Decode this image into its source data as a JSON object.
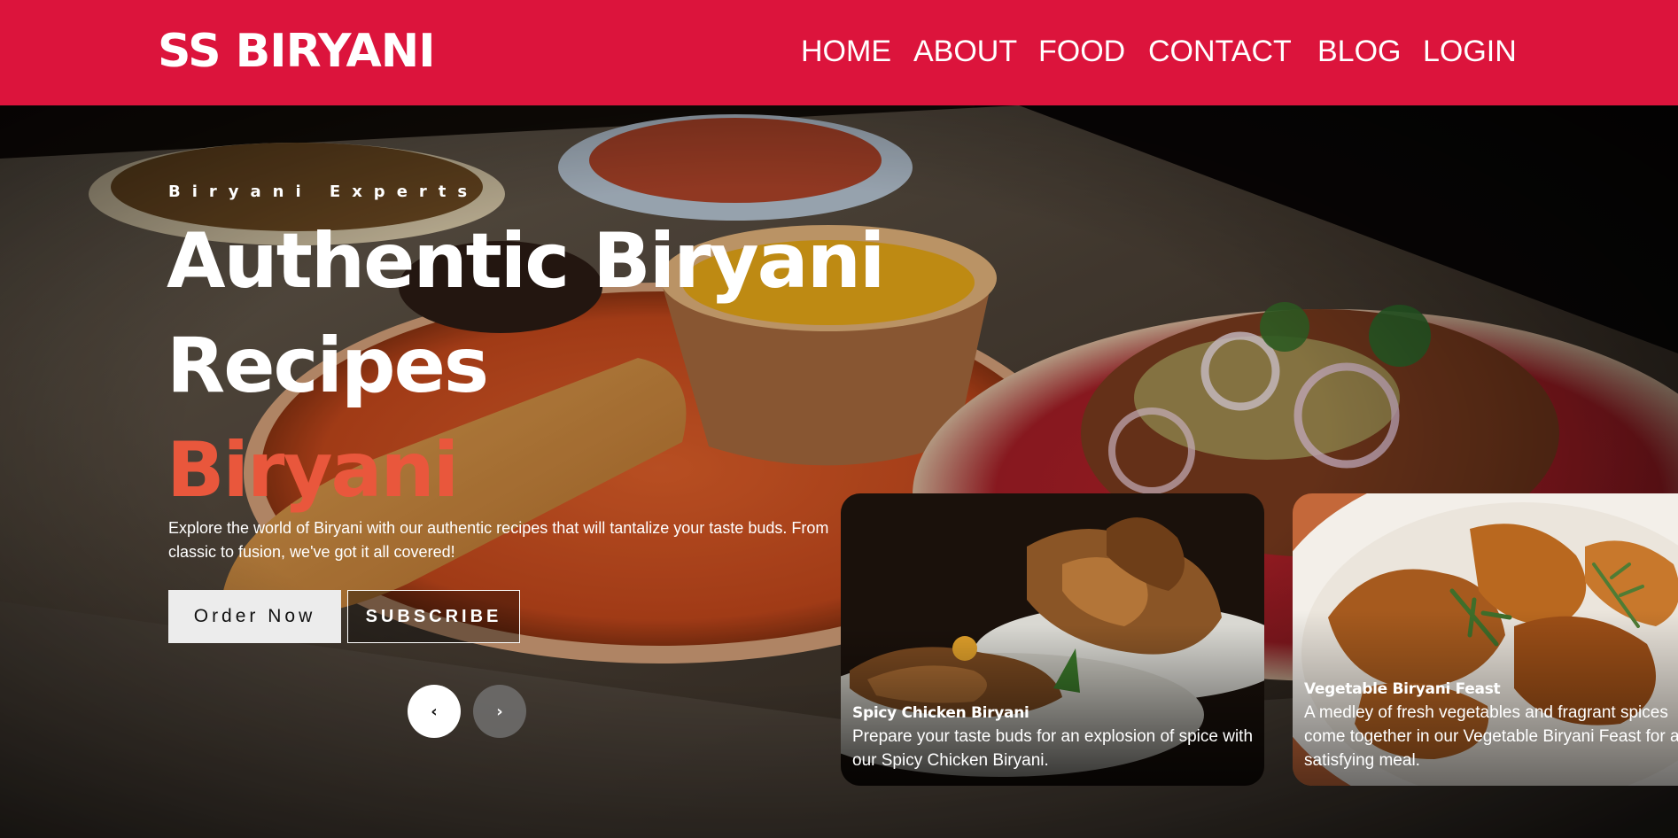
{
  "brand": {
    "name": "SS BIRYANI",
    "primary_color": "#dc143c",
    "accent_color": "#e9573c"
  },
  "nav": {
    "items": [
      {
        "label": "HOME"
      },
      {
        "label": "ABOUT"
      },
      {
        "label": "FOOD"
      },
      {
        "label": "CONTACT"
      },
      {
        "label": "BLOG"
      },
      {
        "label": "LOGIN"
      }
    ]
  },
  "hero": {
    "eyebrow": "Biryani Experts",
    "headline_line1": "Authentic Biryani",
    "headline_line2": "Recipes",
    "headline_accent": "Biryani",
    "tagline": "Explore the world of Biryani with our authentic recipes that will tantalize your taste buds. From classic to fusion, we've got it all covered!",
    "order_button": "Order Now",
    "subscribe_button": "SUBSCRIBE",
    "prev_icon": "chevron-left-icon",
    "next_icon": "chevron-right-icon",
    "prev_glyph": "‹",
    "next_glyph": "›"
  },
  "cards": [
    {
      "title": "Spicy Chicken Biryani",
      "description": "Prepare your taste buds for an explosion of spice with our Spicy Chicken Biryani."
    },
    {
      "title": "Vegetable Biryani Feast",
      "description": "A medley of fresh vegetables and fragrant spices come together in our Vegetable Biryani Feast for a satisfying meal."
    }
  ]
}
